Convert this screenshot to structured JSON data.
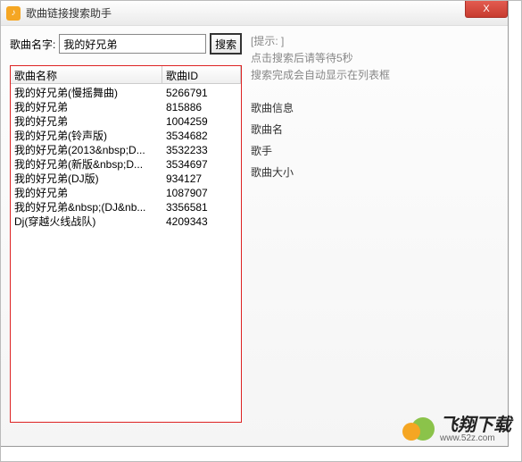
{
  "titlebar": {
    "title": "歌曲链接搜索助手",
    "close": "X"
  },
  "search": {
    "label": "歌曲名字:",
    "value": "我的好兄弟",
    "button": "搜索"
  },
  "hint": {
    "line1": "[提示: ]",
    "line2": "点击搜索后请等待5秒",
    "line3": "搜索完成会自动显示在列表框"
  },
  "table": {
    "col_name": "歌曲名称",
    "col_id": "歌曲ID",
    "rows": [
      {
        "name": "我的好兄弟(慢摇舞曲)",
        "id": "5266791"
      },
      {
        "name": "我的好兄弟",
        "id": "815886"
      },
      {
        "name": "我的好兄弟",
        "id": "1004259"
      },
      {
        "name": "我的好兄弟(铃声版)",
        "id": "3534682"
      },
      {
        "name": "我的好兄弟(2013&nbsp;D...",
        "id": "3532233"
      },
      {
        "name": "我的好兄弟(新版&nbsp;D...",
        "id": "3534697"
      },
      {
        "name": "我的好兄弟(DJ版)",
        "id": "934127"
      },
      {
        "name": "我的好兄弟",
        "id": "1087907"
      },
      {
        "name": "我的好兄弟&nbsp;(DJ&nb...",
        "id": "3356581"
      },
      {
        "name": "Dj(穿越火线战队)",
        "id": "4209343"
      }
    ]
  },
  "info": {
    "heading": "歌曲信息",
    "song_name": "歌曲名",
    "artist": "歌手",
    "size": "歌曲大小"
  },
  "logo": {
    "brand": "飞翔下载",
    "url": "www.52z.com"
  }
}
